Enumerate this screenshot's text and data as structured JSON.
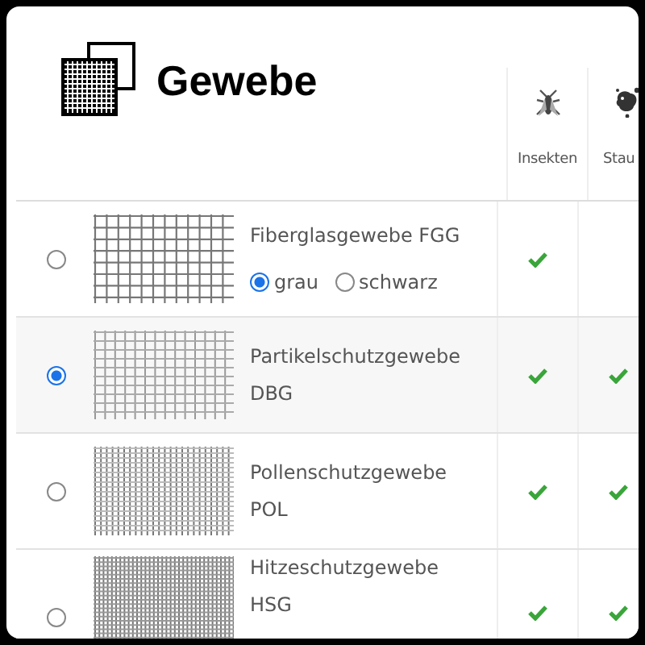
{
  "title": "Gewebe",
  "columns": [
    {
      "label": "Insekten",
      "kind": "fly"
    },
    {
      "label": "Stau",
      "kind": "dust"
    }
  ],
  "rows": [
    {
      "selected": false,
      "kind": "coarse",
      "lines": [
        "Fiberglasgewebe FGG"
      ],
      "options": [
        {
          "label": "grau",
          "selected": true
        },
        {
          "label": "schwarz",
          "selected": false
        }
      ],
      "checks": [
        true,
        false
      ]
    },
    {
      "selected": true,
      "kind": "fine",
      "lines": [
        "Partikelschutzgewebe",
        "DBG"
      ],
      "checks": [
        true,
        true
      ]
    },
    {
      "selected": false,
      "kind": "pollen",
      "lines": [
        "Pollenschutzgewebe",
        "POL"
      ],
      "checks": [
        true,
        true
      ]
    },
    {
      "selected": false,
      "kind": "dense",
      "lines": [
        "Hitzeschutzgewebe",
        "HSG"
      ],
      "checks": [
        true,
        true
      ]
    }
  ]
}
